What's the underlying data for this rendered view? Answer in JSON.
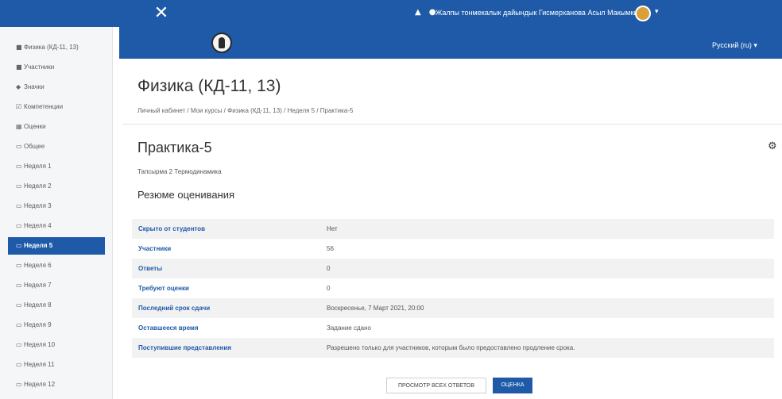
{
  "topbar": {
    "close_glyph": "✕",
    "icons": [
      "bell-icon",
      "chat-icon"
    ],
    "username": "Жалпы тонмекалык дайындык Гисмерханова Асыл Макымкизи"
  },
  "header": {
    "language": "Русский (ru) ▾"
  },
  "sidebar": {
    "items": [
      {
        "icon": "■",
        "label": "Физика (КД-11, 13)"
      },
      {
        "icon": "■",
        "label": "Участники"
      },
      {
        "icon": "◆",
        "label": "Значки"
      },
      {
        "icon": "☑",
        "label": "Компетенции"
      },
      {
        "icon": "▦",
        "label": "Оценки"
      },
      {
        "icon": "▭",
        "label": "Общее"
      },
      {
        "icon": "▭",
        "label": "Неделя 1"
      },
      {
        "icon": "▭",
        "label": "Неделя 2"
      },
      {
        "icon": "▭",
        "label": "Неделя 3"
      },
      {
        "icon": "▭",
        "label": "Неделя 4"
      },
      {
        "icon": "▭",
        "label": "Неделя 5",
        "active": true
      },
      {
        "icon": "▭",
        "label": "Неделя 6"
      },
      {
        "icon": "▭",
        "label": "Неделя 7"
      },
      {
        "icon": "▭",
        "label": "Неделя 8"
      },
      {
        "icon": "▭",
        "label": "Неделя 9"
      },
      {
        "icon": "▭",
        "label": "Неделя 10"
      },
      {
        "icon": "▭",
        "label": "Неделя 11"
      },
      {
        "icon": "▭",
        "label": "Неделя 12"
      }
    ]
  },
  "main": {
    "title": "Физика (КД-11, 13)",
    "breadcrumb": "Личный кабинет / Мои курсы / Физика (КД-11, 13) / Неделя 5 / Практика-5",
    "activity_title": "Практика-5",
    "activity_desc": "Тапсырма 2 Термодинамика",
    "section_title": "Резюме оценивания",
    "summary": [
      {
        "key": "Скрыто от студентов",
        "value": "Нет"
      },
      {
        "key": "Участники",
        "value": "56"
      },
      {
        "key": "Ответы",
        "value": "0"
      },
      {
        "key": "Требуют оценки",
        "value": "0"
      },
      {
        "key": "Последний срок сдачи",
        "value": "Воскресенье, 7 Март 2021, 20:00"
      },
      {
        "key": "Оставшееся время",
        "value": "Задание сдано"
      },
      {
        "key": "Поступившие представления",
        "value": "Разрешено только для участников, которым было предоставлено продление срока."
      }
    ],
    "btn_view_all": "ПРОСМОТР ВСЕХ ОТВЕТОВ",
    "btn_grade": "ОЦЕНКА"
  },
  "colors": {
    "brand": "#1e5aa8",
    "sidebar_bg": "#f5f6f7",
    "row_alt": "#f2f2f2"
  }
}
